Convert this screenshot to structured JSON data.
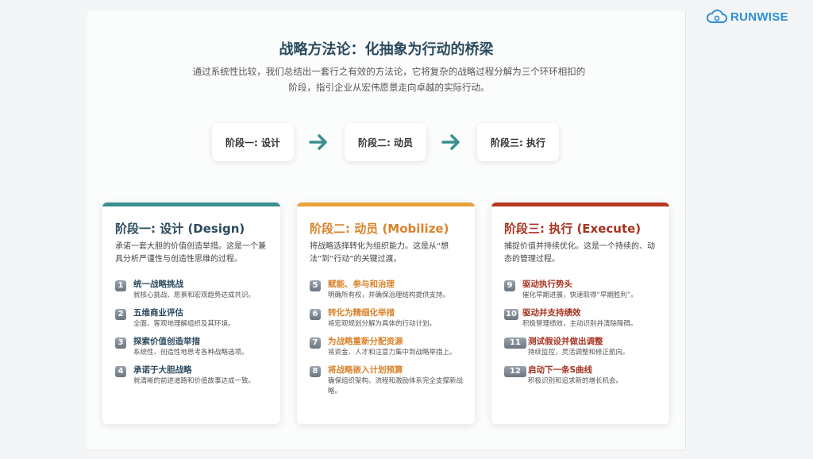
{
  "brand": {
    "name": "RUNWISE",
    "icon": "cloud-gear-icon",
    "color": "#2a8fd6"
  },
  "colors": {
    "stage1": "#3a8f8f",
    "stage2": "#e8a23a",
    "stage3": "#b4391f",
    "arrow": "#3a8f8f"
  },
  "header": {
    "title": "战略方法论：化抽象为行动的桥梁",
    "subtitle": "通过系统性比较，我们总结出一套行之有效的方法论，它将复杂的战略过程分解为三个环环相扣的阶段，指引企业从宏伟愿景走向卓越的实际行动。"
  },
  "flow": [
    {
      "label": "阶段一: 设计"
    },
    {
      "label": "阶段二: 动员"
    },
    {
      "label": "阶段三: 执行"
    }
  ],
  "cards": [
    {
      "title": "阶段一: 设计 (Design)",
      "desc": "承诺一套大胆的价值创造举措。这是一个兼具分析严谨性与创造性思维的过程。",
      "items": [
        {
          "num": "1",
          "title": "统一战略挑战",
          "desc": "就核心挑战、愿景和宏观趋势达成共识。"
        },
        {
          "num": "2",
          "title": "五维商业评估",
          "desc": "全面、客观地理解组织及其环境。"
        },
        {
          "num": "3",
          "title": "探索价值创造举措",
          "desc": "系统性、创造性地思考各种战略选项。"
        },
        {
          "num": "4",
          "title": "承诺于大胆战略",
          "desc": "就清晰的前进道路和价值故事达成一致。"
        }
      ]
    },
    {
      "title": "阶段二: 动员 (Mobilize)",
      "desc": "将战略选择转化为组织能力。这是从“想法”到“行动”的关键过渡。",
      "items": [
        {
          "num": "5",
          "title": "赋能、参与和治理",
          "desc": "明确所有权，并确保治理结构提供支持。"
        },
        {
          "num": "6",
          "title": "转化为精细化举措",
          "desc": "将宏观规划分解为具体的行动计划。"
        },
        {
          "num": "7",
          "title": "为战略重新分配资源",
          "desc": "将资金、人才和注意力集中到战略举措上。"
        },
        {
          "num": "8",
          "title": "将战略嵌入计划预算",
          "desc": "确保组织架构、流程和激励体系完全支撑新战略。"
        }
      ]
    },
    {
      "title": "阶段三: 执行 (Execute)",
      "desc": "捕捉价值并持续优化。这是一个持续的、动态的管理过程。",
      "items": [
        {
          "num": "9",
          "title": "驱动执行势头",
          "desc": "催化早期进展，快速取得“早期胜利”。"
        },
        {
          "num": "10",
          "title": "驱动并支持绩效",
          "desc": "积极管理绩效，主动识别并清除障碍。"
        },
        {
          "num": "11",
          "title": "测试假设并做出调整",
          "desc": "持续监控，灵活调整和修正航向。"
        },
        {
          "num": "12",
          "title": "启动下一条S曲线",
          "desc": "积极识别和追求新的增长机会。"
        }
      ]
    }
  ]
}
